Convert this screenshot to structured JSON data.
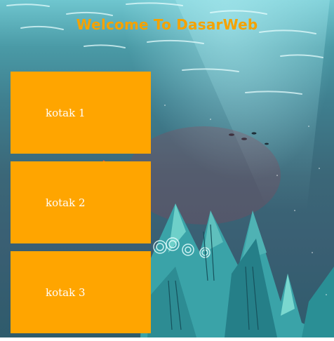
{
  "page": {
    "title": "Welcome To DasarWeb"
  },
  "boxes": [
    {
      "label": "kotak 1"
    },
    {
      "label": "kotak 2"
    },
    {
      "label": "kotak 3"
    }
  ],
  "colors": {
    "title": "#f5a200",
    "box": "#ffa500",
    "box_text": "#ffffff",
    "water_top": "#6fc6cf",
    "water_deep": "#2f5b6c"
  }
}
